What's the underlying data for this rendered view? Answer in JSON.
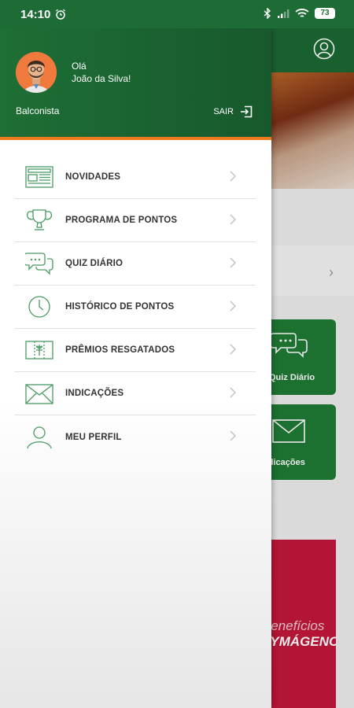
{
  "status_bar": {
    "time": "14:10",
    "battery": "73"
  },
  "user": {
    "greeting": "Olá",
    "name": "João da Silva!",
    "role": "Balconista"
  },
  "logout_label": "SAIR",
  "menu": [
    {
      "label": "NOVIDADES",
      "icon": "newspaper-icon"
    },
    {
      "label": "PROGRAMA DE PONTOS",
      "icon": "trophy-icon"
    },
    {
      "label": "QUIZ DIÁRIO",
      "icon": "chat-bubbles-icon"
    },
    {
      "label": "HISTÓRICO DE PONTOS",
      "icon": "clock-icon"
    },
    {
      "label": "PRÊMIOS RESGATADOS",
      "icon": "gift-ticket-icon"
    },
    {
      "label": "INDICAÇÕES",
      "icon": "envelope-icon"
    },
    {
      "label": "MEU PERFIL",
      "icon": "user-icon"
    }
  ],
  "background": {
    "card_quiz_label": "Quiz Diário",
    "card_indicacoes_label": "Indicações",
    "promo_line1": "Benefícios",
    "promo_line2": "ZYMÁGENO"
  },
  "colors": {
    "primary_green": "#1d6b35",
    "accent_orange": "#ee7a1f",
    "icon_green": "#4a9a63",
    "promo_red": "#c2173a"
  }
}
